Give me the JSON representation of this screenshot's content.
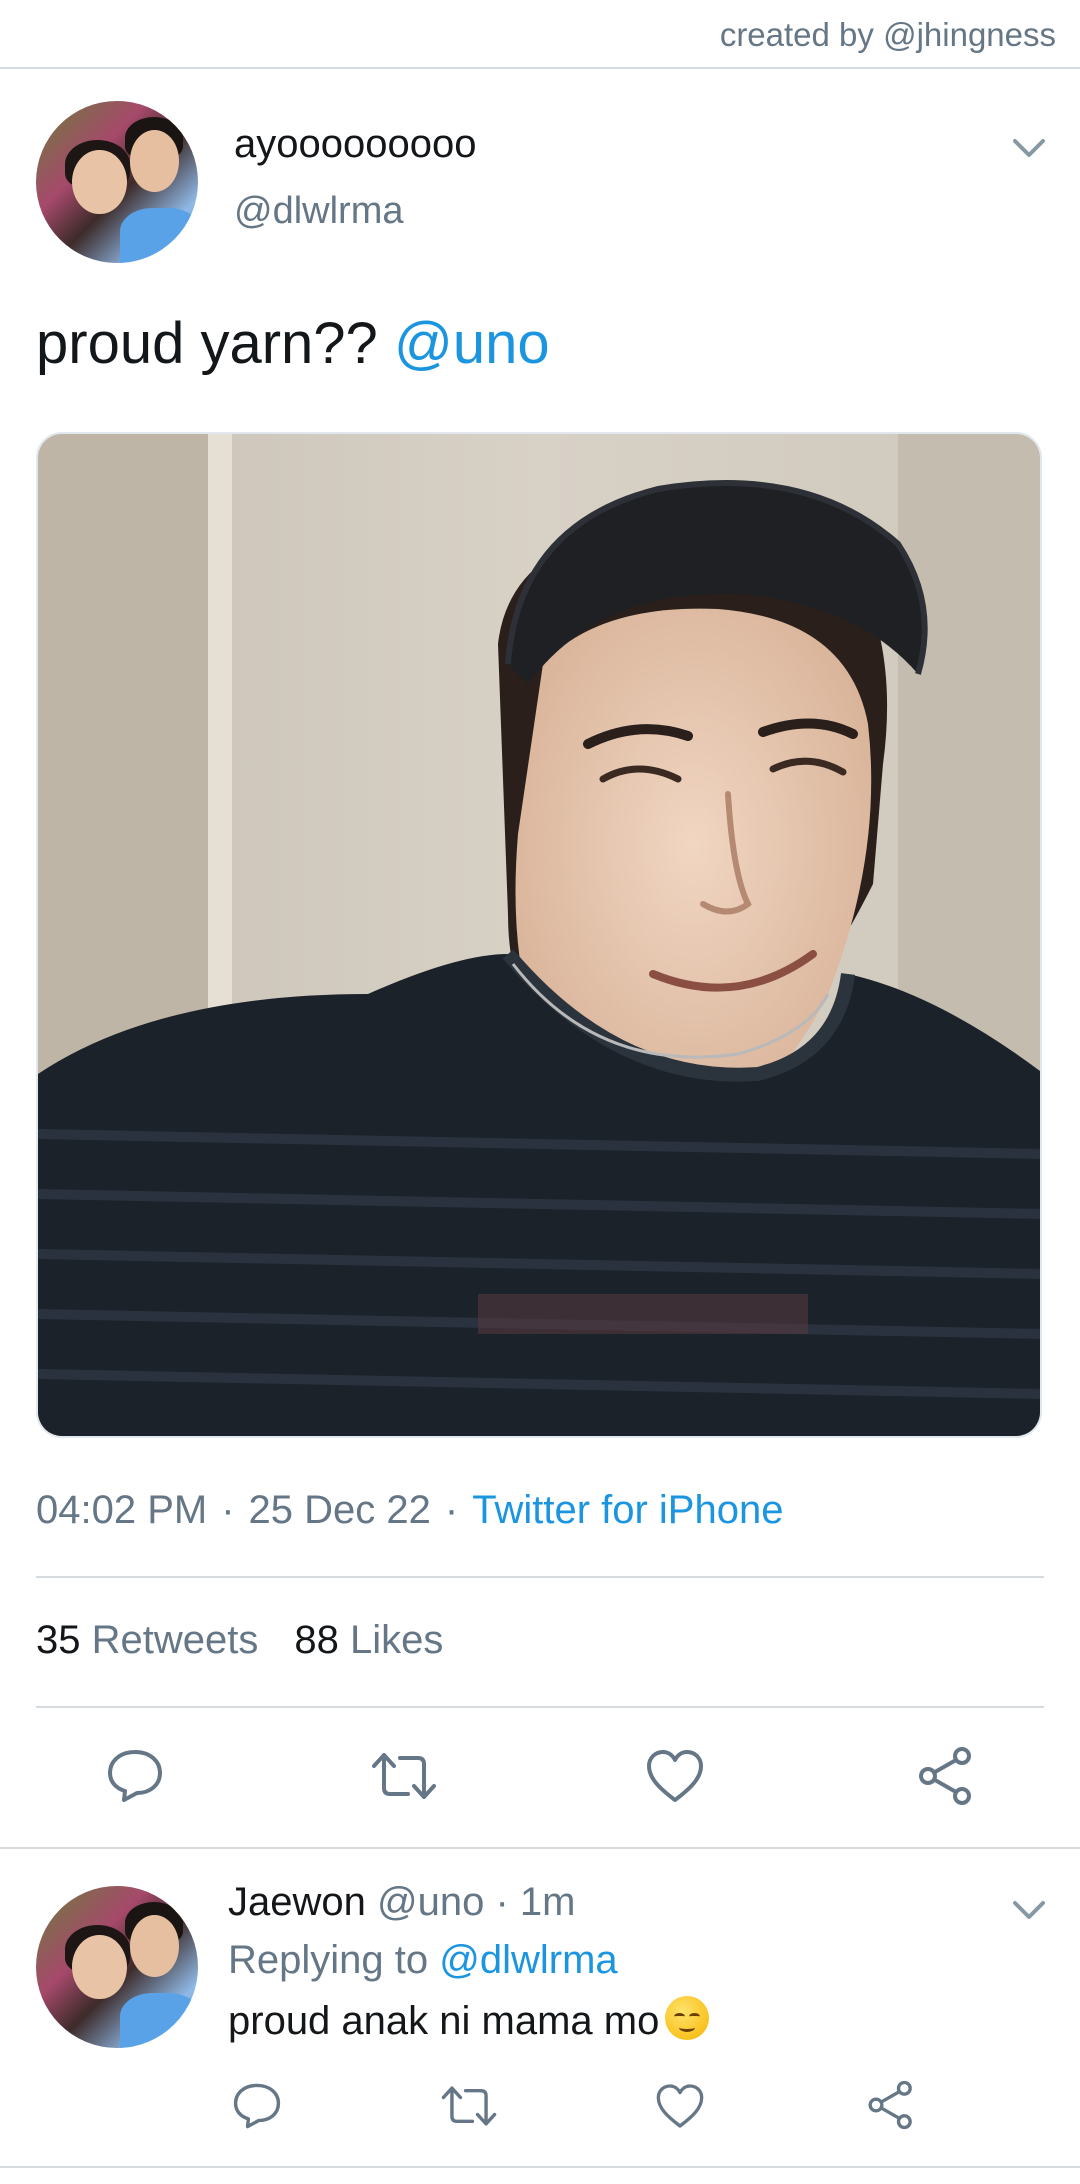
{
  "header": {
    "credit": "created by @jhingness"
  },
  "tweet": {
    "display_name": "ayooooooooo",
    "handle": "@dlwlrma",
    "text": "proud yarn??",
    "mention": "@uno",
    "time": "04:02 PM",
    "date": "25 Dec 22",
    "separator": "·",
    "source": "Twitter for iPhone",
    "retweets_count": "35",
    "retweets_label": "Retweets",
    "likes_count": "88",
    "likes_label": "Likes"
  },
  "reply": {
    "display_name": "Jaewon",
    "handle": "@uno",
    "separator": "·",
    "time": "1m",
    "replying_label": "Replying to",
    "replying_handle": "@dlwlrma",
    "text": "proud anak ni mama mo",
    "emoji": "relieved-face-emoji"
  },
  "icons": {
    "reply": "reply-icon",
    "retweet": "retweet-icon",
    "like": "heart-icon",
    "share": "share-icon",
    "more": "chevron-down-icon"
  },
  "colors": {
    "accent": "#1b95e0",
    "secondary_text": "#657786",
    "divider": "#d6dbdf"
  }
}
